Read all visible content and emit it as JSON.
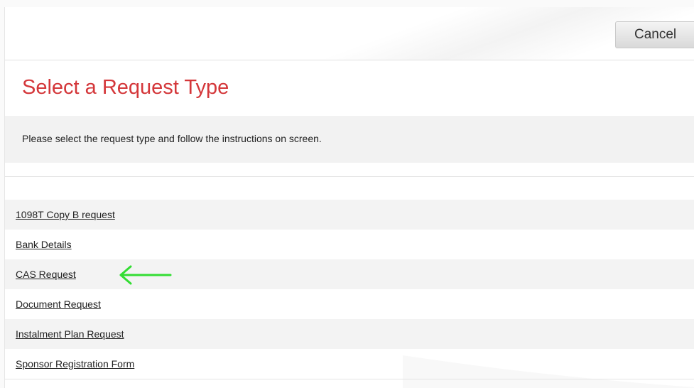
{
  "toolbar": {
    "cancel_label": "Cancel"
  },
  "header": {
    "title": "Select a Request Type"
  },
  "instructions": {
    "text": "Please select the request type and follow the instructions on screen."
  },
  "request_types": [
    {
      "label": "1098T Copy B request"
    },
    {
      "label": "Bank Details"
    },
    {
      "label": "CAS Request"
    },
    {
      "label": "Document Request"
    },
    {
      "label": "Instalment Plan Request"
    },
    {
      "label": "Sponsor Registration Form"
    }
  ],
  "annotation": {
    "icon": "left-arrow-icon",
    "color": "#33dd33",
    "points_to": "CAS Request"
  },
  "colors": {
    "title": "#d4373a",
    "stripe": "#f3f3f3"
  }
}
